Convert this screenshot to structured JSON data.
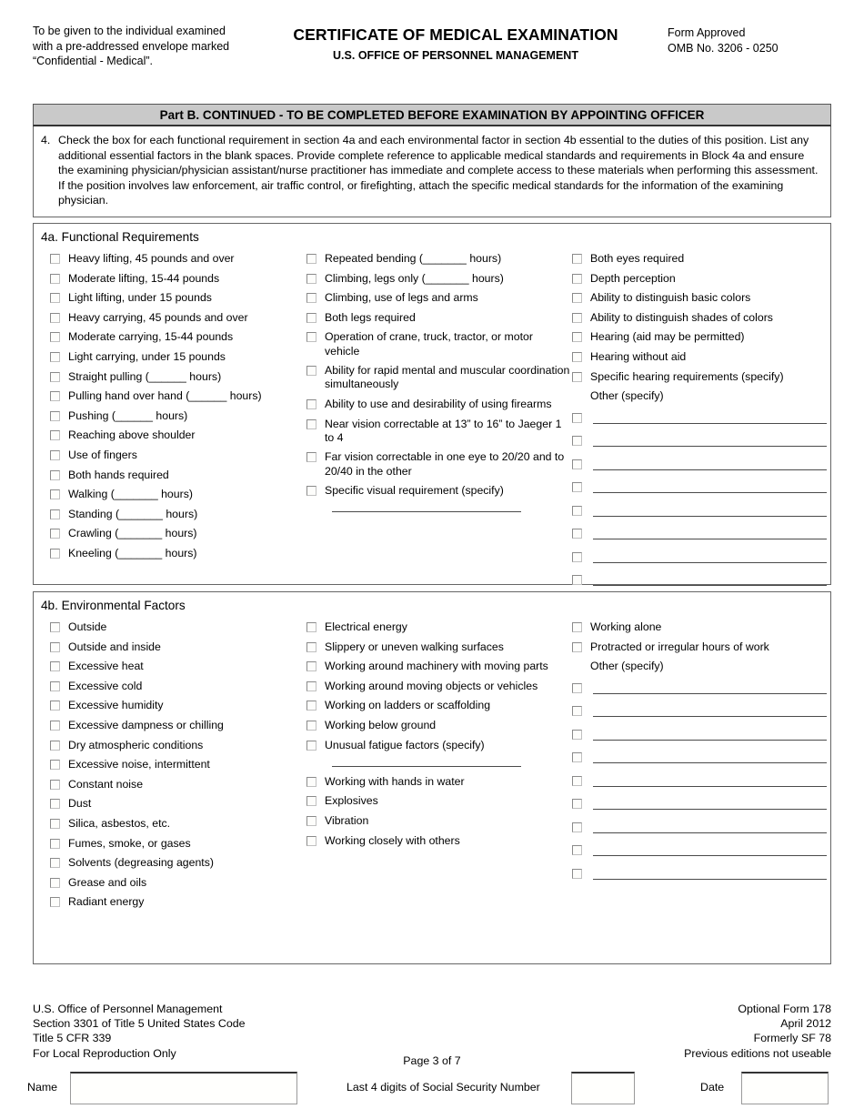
{
  "header": {
    "left_note": "To be given to the individual examined with a pre-addressed envelope marked “Confidential - Medical”.",
    "title": "CERTIFICATE OF MEDICAL EXAMINATION",
    "subtitle": "U.S. OFFICE OF PERSONNEL MANAGEMENT",
    "form_approved": "Form Approved",
    "omb": "OMB No. 3206 - 0250"
  },
  "part_b": {
    "bar_title": "Part B.  CONTINUED  - TO BE COMPLETED BEFORE EXAMINATION BY APPOINTING OFFICER",
    "instruction_number": "4.",
    "instruction_text": "Check the box for each functional requirement in section 4a and each environmental factor in section 4b essential to the duties of this position. List any additional essential factors in the blank spaces. Provide complete reference to applicable medical standards and requirements in Block 4a and ensure the examining physician/physician assistant/nurse practitioner has immediate and complete access to these materials when performing this assessment. If the position involves law enforcement, air traffic control, or firefighting, attach the specific medical standards for the information of the examining physician."
  },
  "section_4a": {
    "title": "4a. Functional Requirements",
    "column_1": [
      "Heavy lifting, 45 pounds and over",
      "Moderate lifting, 15-44 pounds",
      "Light lifting, under 15 pounds",
      "Heavy carrying, 45 pounds and over",
      "Moderate carrying, 15-44 pounds",
      "Light carrying, under 15 pounds",
      "Straight pulling (______ hours)",
      "Pulling hand over hand (______ hours)",
      "Pushing (______ hours)",
      "Reaching above shoulder",
      "Use of fingers",
      "Both hands required",
      "Walking (_______ hours)",
      "Standing (_______ hours)",
      "Crawling (_______ hours)",
      "Kneeling (_______ hours)"
    ],
    "column_2": [
      "Repeated bending (_______ hours)",
      "Climbing, legs only (_______ hours)",
      "Climbing, use of legs and arms",
      "Both legs required",
      "Operation of crane, truck, tractor, or motor vehicle",
      "Ability for rapid mental and muscular coordination simultaneously",
      "Ability to use and desirability of using firearms",
      "Near vision correctable at 13” to 16” to Jaeger 1 to 4",
      "Far vision correctable in one eye to 20/20 and to 20/40 in the other",
      "Specific visual requirement (specify)"
    ],
    "column_3": [
      "Both eyes required",
      "Depth perception",
      "Ability to distinguish basic colors",
      "Ability to distinguish shades of colors",
      "Hearing (aid may be permitted)",
      "Hearing without aid",
      "Specific hearing requirements (specify)"
    ],
    "other_label": "Other (specify)",
    "other_blank_count": 8
  },
  "section_4b": {
    "title": "4b. Environmental Factors",
    "column_1": [
      "Outside",
      "Outside and inside",
      "Excessive heat",
      "Excessive cold",
      "Excessive humidity",
      "Excessive dampness or chilling",
      "Dry atmospheric conditions",
      "Excessive noise, intermittent",
      "Constant noise",
      "Dust",
      "Silica, asbestos, etc.",
      "Fumes, smoke, or gases",
      "Solvents (degreasing agents)",
      "Grease and oils",
      "Radiant energy"
    ],
    "column_2_top": [
      "Electrical energy",
      "Slippery or uneven walking surfaces",
      "Working around machinery with moving parts",
      "Working around moving objects or vehicles",
      "Working on ladders or scaffolding",
      "Working below ground",
      "Unusual fatigue factors (specify)"
    ],
    "column_2_bottom": [
      "Working with hands in water",
      "Explosives",
      "Vibration",
      "Working closely with others"
    ],
    "column_3": [
      "Working alone",
      "Protracted or irregular hours of work"
    ],
    "other_label": "Other (specify)",
    "other_blank_count": 9
  },
  "footer": {
    "left_lines": [
      "U.S. Office of Personnel Management",
      "Section 3301 of Title 5 United States Code",
      "Title 5 CFR 339",
      "For Local Reproduction Only"
    ],
    "right_lines": [
      "Optional Form 178",
      "April 2012",
      "Formerly SF 78",
      "Previous editions not useable"
    ],
    "page_number": "Page 3 of 7"
  },
  "id_strip": {
    "name_label": "Name",
    "name_value": "",
    "ssn_label": "Last 4 digits of Social Security Number",
    "ssn_value": "",
    "date_label": "Date",
    "date_value": ""
  }
}
